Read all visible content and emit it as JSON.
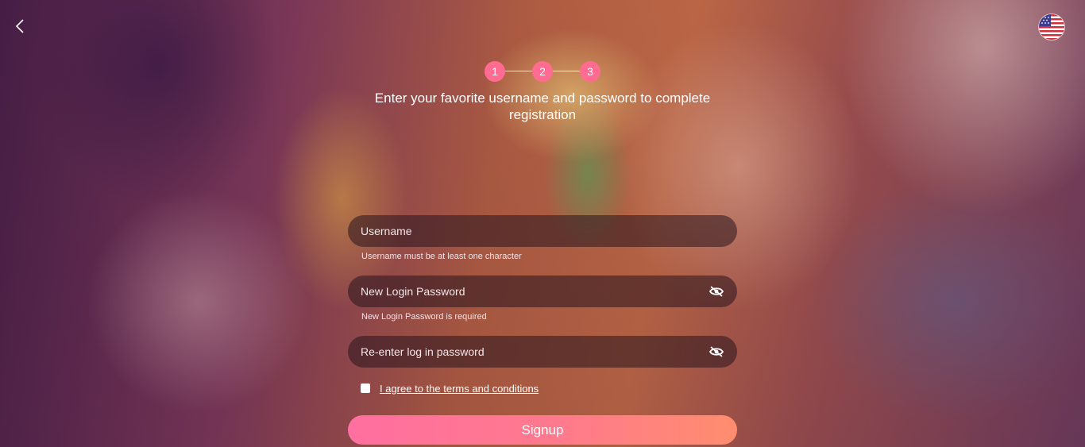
{
  "header": {
    "back_icon": "chevron-left-icon",
    "language_flag_icon": "us-flag-icon"
  },
  "stepper": {
    "steps": [
      "1",
      "2",
      "3"
    ],
    "active_color": "#ff6b91"
  },
  "subtitle": "Enter your favorite username and password to complete registration",
  "form": {
    "username": {
      "placeholder": "Username",
      "hint": "Username must be at least one character"
    },
    "password": {
      "placeholder": "New Login Password",
      "hint": "New Login Password is required",
      "toggle_icon": "eye-off-icon"
    },
    "confirm_password": {
      "placeholder": "Re-enter log in password",
      "toggle_icon": "eye-off-icon"
    },
    "terms": {
      "label": "I agree to the terms and conditions",
      "checked": false
    },
    "submit_label": "Signup"
  },
  "colors": {
    "accent": "#ff6b91",
    "button_gradient_start": "#ff6fa0",
    "button_gradient_end": "#ff8d6e"
  }
}
